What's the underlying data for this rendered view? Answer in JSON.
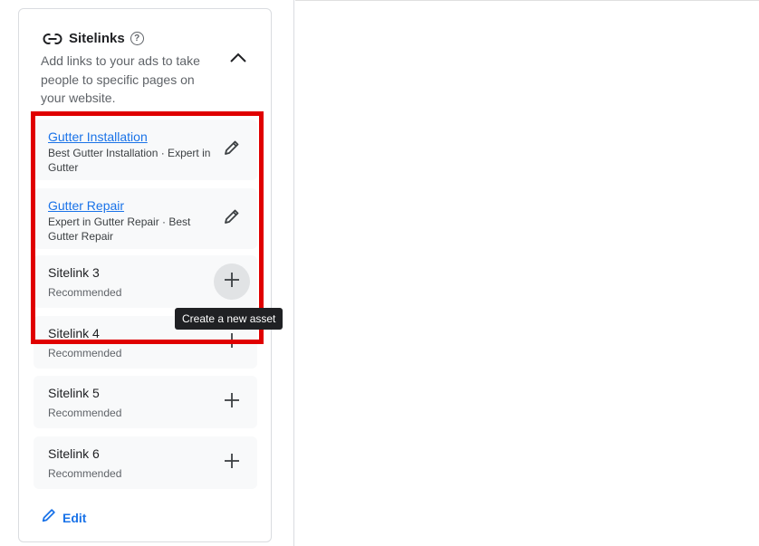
{
  "sitelinks": {
    "title": "Sitelinks",
    "help_icon": "?",
    "description": "Add links to your ads to take people to specific pages on your website.",
    "items": [
      {
        "title": "Gutter Installation",
        "subtitle": "Best Gutter Installation · Expert in Gutter",
        "action_icon": "pencil-icon",
        "is_link": true
      },
      {
        "title": "Gutter Repair",
        "subtitle": "Expert in Gutter Repair · Best Gutter Repair",
        "action_icon": "pencil-icon",
        "is_link": true
      },
      {
        "title": "Sitelink 3",
        "subtitle": "Recommended",
        "action_icon": "plus-icon",
        "is_link": false
      },
      {
        "title": "Sitelink 4",
        "subtitle": "Recommended",
        "action_icon": "plus-icon",
        "is_link": false
      },
      {
        "title": "Sitelink 5",
        "subtitle": "Recommended",
        "action_icon": "plus-icon",
        "is_link": false
      },
      {
        "title": "Sitelink 6",
        "subtitle": "Recommended",
        "action_icon": "plus-icon",
        "is_link": false
      }
    ],
    "edit_label": "Edit",
    "tooltip": "Create a new asset"
  },
  "colors": {
    "link_blue": "#1a73e8",
    "highlight_red": "#e00000",
    "tooltip_bg": "#202124",
    "item_bg": "#f8f9fa"
  }
}
